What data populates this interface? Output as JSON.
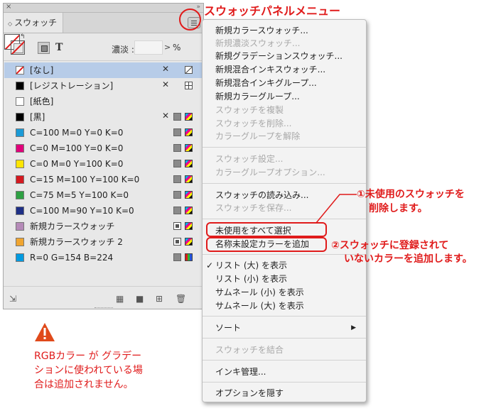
{
  "panel": {
    "tab_label": "スウォッチ",
    "close_glyph": "×",
    "tint_label": "濃淡 :",
    "tint_value": "",
    "tint_unit": "%",
    "swatches": [
      {
        "name": "[なし]",
        "color": "none",
        "selected": true
      },
      {
        "name": "[レジストレーション]",
        "color": "#000000"
      },
      {
        "name": "[紙色]",
        "color": "#ffffff"
      },
      {
        "name": "[黒]",
        "color": "#000000"
      },
      {
        "name": "C=100 M=0 Y=0 K=0",
        "color": "#1b9ad6"
      },
      {
        "name": "C=0 M=100 Y=0 K=0",
        "color": "#e0007a"
      },
      {
        "name": "C=0 M=0 Y=100 K=0",
        "color": "#ffe500"
      },
      {
        "name": "C=15 M=100 Y=100 K=0",
        "color": "#d41920"
      },
      {
        "name": "C=75 M=5 Y=100 K=0",
        "color": "#2ea043"
      },
      {
        "name": "C=100 M=90 Y=10 K=0",
        "color": "#1e2f86"
      },
      {
        "name": "新規カラースウォッチ",
        "color": "#b58ab8"
      },
      {
        "name": "新規カラースウォッチ 2",
        "color": "#f0a530"
      },
      {
        "name": "R=0 G=154 B=224",
        "color": "#009ae0"
      }
    ]
  },
  "menu": {
    "items": [
      {
        "label": "新規カラースウォッチ...",
        "disabled": false
      },
      {
        "label": "新規濃淡スウォッチ...",
        "disabled": true
      },
      {
        "label": "新規グラデーションスウォッチ...",
        "disabled": false
      },
      {
        "label": "新規混合インキスウォッチ...",
        "disabled": false
      },
      {
        "label": "新規混合インキグループ...",
        "disabled": false
      },
      {
        "label": "新規カラーグループ...",
        "disabled": false
      },
      {
        "label": "スウォッチを複製",
        "disabled": true
      },
      {
        "label": "スウォッチを削除...",
        "disabled": true
      },
      {
        "label": "カラーグループを解除",
        "disabled": true
      },
      {
        "label": "スウォッチ設定...",
        "disabled": true
      },
      {
        "label": "カラーグループオプション...",
        "disabled": true
      },
      {
        "label": "スウォッチの読み込み...",
        "disabled": false
      },
      {
        "label": "スウォッチを保存...",
        "disabled": true
      },
      {
        "label": "未使用をすべて選択",
        "disabled": false
      },
      {
        "label": "名称未設定カラーを追加",
        "disabled": false
      },
      {
        "label": "リスト (大) を表示",
        "disabled": false,
        "checked": true
      },
      {
        "label": "リスト (小) を表示",
        "disabled": false
      },
      {
        "label": "サムネール (小) を表示",
        "disabled": false
      },
      {
        "label": "サムネール (大) を表示",
        "disabled": false
      },
      {
        "label": "ソート",
        "disabled": false,
        "submenu": true
      },
      {
        "label": "スウォッチを結合",
        "disabled": true
      },
      {
        "label": "インキ管理...",
        "disabled": false
      },
      {
        "label": "オプションを隠す",
        "disabled": false
      }
    ],
    "check_glyph": "✓",
    "submenu_glyph": "▶"
  },
  "annotations": {
    "menu_title": "スウォッチパネルメニュー",
    "note1_line1": "①未使用のスウォッチを",
    "note1_line2": "削除します。",
    "note2_line1": "②スウォッチに登録されて",
    "note2_line2": "いないカラーを追加します。",
    "warning_line1": "RGBカラー が グラデー",
    "warning_line2": "ションに使われている場",
    "warning_line3": "合は追加されません。",
    "accent_color": "#e01b1b"
  }
}
